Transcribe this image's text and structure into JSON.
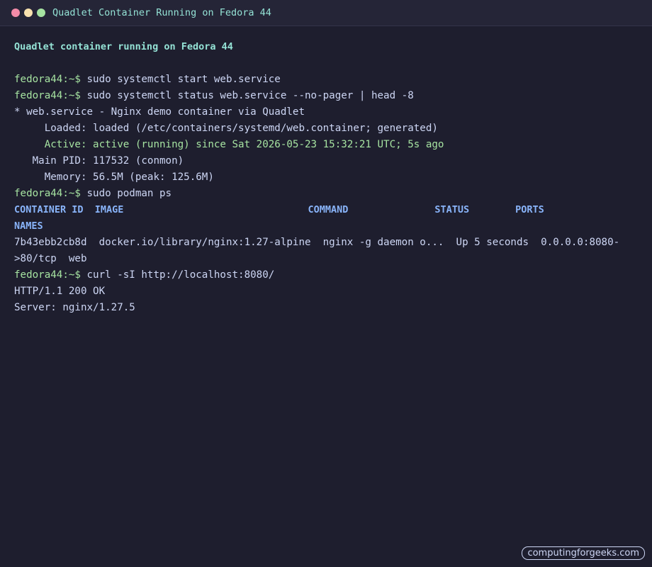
{
  "window": {
    "title": "Quadlet Container Running on Fedora 44"
  },
  "terminal": {
    "heading": "Quadlet container running on Fedora 44",
    "prompt": "fedora44:~$",
    "cmd1": " sudo systemctl start web.service",
    "cmd2": " sudo systemctl status web.service --no-pager | head -8",
    "status_unit": "* web.service - Nginx demo container via Quadlet",
    "status_loaded": "     Loaded: loaded (/etc/containers/systemd/web.container; generated)",
    "status_active": "     Active: active (running) since Sat 2026-05-23 15:32:21 UTC; 5s ago",
    "status_pid": "   Main PID: 117532 (conmon)",
    "status_memory": "     Memory: 56.5M (peak: 125.6M)",
    "cmd3": " sudo podman ps",
    "ps_header": "CONTAINER ID  IMAGE                                COMMAND               STATUS        PORTS",
    "ps_header2": "NAMES",
    "ps_row": "7b43ebb2cb8d  docker.io/library/nginx:1.27-alpine  nginx -g daemon o...  Up 5 seconds  0.0.0.0:8080-",
    "ps_row2": ">80/tcp  web",
    "cmd4": " curl -sI http://localhost:8080/",
    "http_status": "HTTP/1.1 200 OK",
    "http_server": "Server: nginx/1.27.5"
  },
  "watermark": "computingforgeeks.com",
  "colors": {
    "background": "#1e1e2e",
    "prompt": "#a6e3a1",
    "heading": "#94e2d5",
    "table_header": "#89b4fa"
  }
}
